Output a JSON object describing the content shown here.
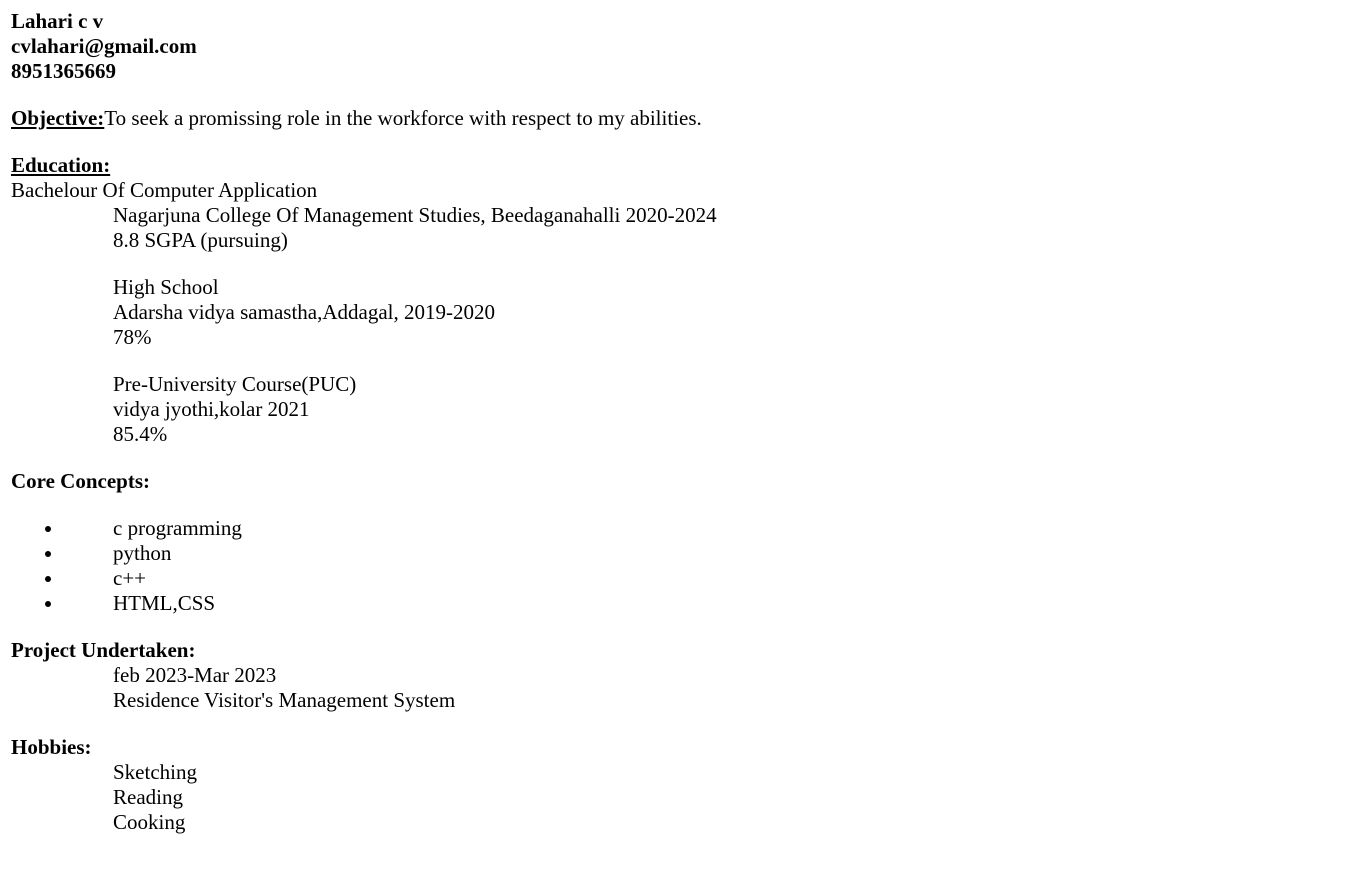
{
  "header": {
    "name": "Lahari c v",
    "email": "cvlahari@gmail.com",
    "phone": "8951365669"
  },
  "objective": {
    "heading": "Objective:",
    "text": "To seek a promissing role in the workforce with respect to my abilities."
  },
  "education": {
    "heading": "Education:",
    "degree_title": "Bachelour Of Computer Application",
    "degree_college": "Nagarjuna College Of Management Studies, Beedaganahalli 2020-2024",
    "degree_score": "8.8 SGPA (pursuing)",
    "school_title": "High School",
    "school_name": "Adarsha vidya samastha,Addagal, 2019-2020",
    "school_score": "78%",
    "puc_title": "Pre-University Course(PUC)",
    "puc_name": "vidya jyothi,kolar 2021",
    "puc_score": "85.4%"
  },
  "core_concepts": {
    "heading": "Core Concepts:",
    "items": [
      "c programming",
      "python",
      "c++",
      "HTML,CSS"
    ]
  },
  "project": {
    "heading": "Project Undertaken:",
    "period": "feb 2023-Mar 2023",
    "title": "Residence Visitor's Management System"
  },
  "hobbies": {
    "heading": "Hobbies:",
    "items": [
      "Sketching",
      "Reading",
      "Cooking"
    ]
  }
}
